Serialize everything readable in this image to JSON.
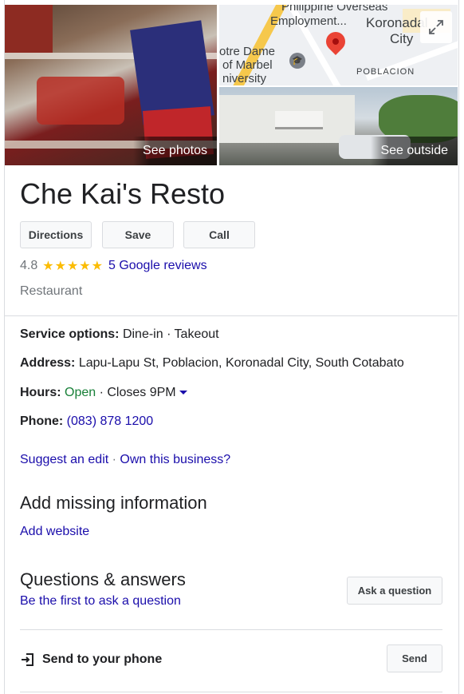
{
  "photos": {
    "see_photos_label": "See photos",
    "see_outside_label": "See outside",
    "map_labels": {
      "employment_line1": "Philippine Overseas",
      "employment_line2": "Employment...",
      "city_line1": "Koronadal",
      "city_line2": "City",
      "school_line1": "otre Dame",
      "school_line2": "of Marbel",
      "school_line3": "niversity",
      "district": "POBLACION"
    }
  },
  "business": {
    "name": "Che Kai's Resto",
    "actions": {
      "directions": "Directions",
      "save": "Save",
      "call": "Call"
    },
    "rating": "4.8",
    "stars": "★★★★★",
    "reviews_link": "5 Google reviews",
    "category": "Restaurant"
  },
  "details": {
    "service_label": "Service options:",
    "service_value": "Dine-in · Takeout",
    "address_label": "Address:",
    "address_value": "Lapu-Lapu St, Poblacion, Koronadal City, South Cotabato",
    "hours_label": "Hours:",
    "hours_open": "Open",
    "hours_sep": " · Closes 9PM",
    "phone_label": "Phone:",
    "phone_value": "(083) 878 1200",
    "suggest_edit": "Suggest an edit",
    "link_sep": " · ",
    "own_business": "Own this business?"
  },
  "missing": {
    "heading": "Add missing information",
    "add_website": "Add website"
  },
  "qa": {
    "heading": "Questions & answers",
    "first_to_ask": "Be the first to ask a question",
    "ask_button": "Ask a question"
  },
  "send": {
    "label": "Send to your phone",
    "button": "Send"
  },
  "colors": {
    "link": "#1a0dab",
    "open": "#188038",
    "star": "#fbbc04",
    "pin": "#ea4335"
  }
}
